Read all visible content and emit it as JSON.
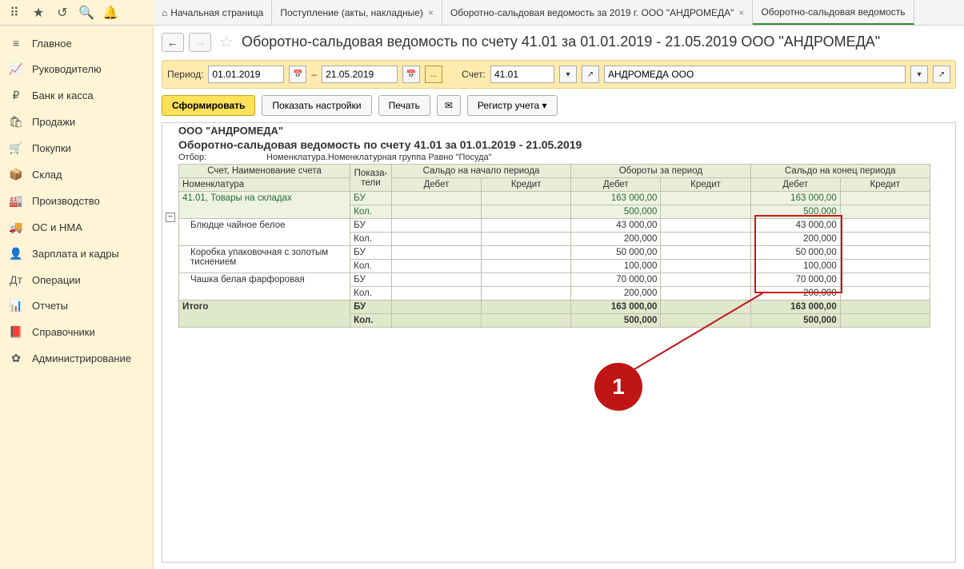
{
  "tabs": [
    {
      "label": "Начальная страница",
      "closable": false,
      "icon": "⌂"
    },
    {
      "label": "Поступление (акты, накладные)",
      "closable": true
    },
    {
      "label": "Оборотно-сальдовая ведомость за 2019 г. ООО \"АНДРОМЕДА\"",
      "closable": true
    },
    {
      "label": "Оборотно-сальдовая ведомость",
      "closable": false,
      "active": true
    }
  ],
  "sidebar": [
    {
      "icon": "≡",
      "label": "Главное"
    },
    {
      "icon": "📈",
      "label": "Руководителю"
    },
    {
      "icon": "₽",
      "label": "Банк и касса"
    },
    {
      "icon": "🛍",
      "label": "Продажи"
    },
    {
      "icon": "🛒",
      "label": "Покупки"
    },
    {
      "icon": "📦",
      "label": "Склад"
    },
    {
      "icon": "🏭",
      "label": "Производство"
    },
    {
      "icon": "🚚",
      "label": "ОС и НМА"
    },
    {
      "icon": "👤",
      "label": "Зарплата и кадры"
    },
    {
      "icon": "Дт",
      "label": "Операции"
    },
    {
      "icon": "📊",
      "label": "Отчеты"
    },
    {
      "icon": "📕",
      "label": "Справочники"
    },
    {
      "icon": "✿",
      "label": "Администрирование"
    }
  ],
  "title": "Оборотно-сальдовая ведомость по счету 41.01 за 01.01.2019 - 21.05.2019 ООО \"АНДРОМЕДА\"",
  "params": {
    "period_label": "Период:",
    "date_from": "01.01.2019",
    "dash": "–",
    "date_to": "21.05.2019",
    "account_label": "Счет:",
    "account": "41.01",
    "org": "АНДРОМЕДА ООО"
  },
  "toolbar": {
    "generate": "Сформировать",
    "settings": "Показать настройки",
    "print": "Печать",
    "register": "Регистр учета ▾"
  },
  "report": {
    "org": "ООО \"АНДРОМЕДА\"",
    "title": "Оборотно-сальдовая ведомость по счету 41.01 за 01.01.2019 - 21.05.2019",
    "filter_label": "Отбор:",
    "filter_value": "Номенклатура.Номенклатурная группа Равно \"Посуда\"",
    "headers": {
      "name1": "Счет, Наименование счета",
      "name2": "Номенклатура",
      "ind": "Показа-\nтели",
      "saldo_begin": "Сальдо на начало периода",
      "turnover": "Обороты за период",
      "saldo_end": "Сальдо на конец периода",
      "debit": "Дебет",
      "credit": "Кредит"
    },
    "account_row": {
      "name": "41.01, Товары на складах",
      "bu_d": "163 000,00",
      "kol_d": "500,000",
      "bu_e": "163 000,00",
      "kol_e": "500,000"
    },
    "items": [
      {
        "name": "Блюдце чайное белое",
        "bu_d": "43 000,00",
        "kol_d": "200,000",
        "bu_e": "43 000,00",
        "kol_e": "200,000"
      },
      {
        "name": "Коробка упаковочная с золотым тиснением",
        "bu_d": "50 000,00",
        "kol_d": "100,000",
        "bu_e": "50 000,00",
        "kol_e": "100,000"
      },
      {
        "name": "Чашка белая фарфоровая",
        "bu_d": "70 000,00",
        "kol_d": "200,000",
        "bu_e": "70 000,00",
        "kol_e": "200,000"
      }
    ],
    "total": {
      "name": "Итого",
      "bu": "БУ",
      "kol": "Кол.",
      "bu_d": "163 000,00",
      "kol_d": "500,000",
      "bu_e": "163 000,00",
      "kol_e": "500,000"
    },
    "ind_bu": "БУ",
    "ind_kol": "Кол."
  },
  "annotation": {
    "number": "1"
  }
}
